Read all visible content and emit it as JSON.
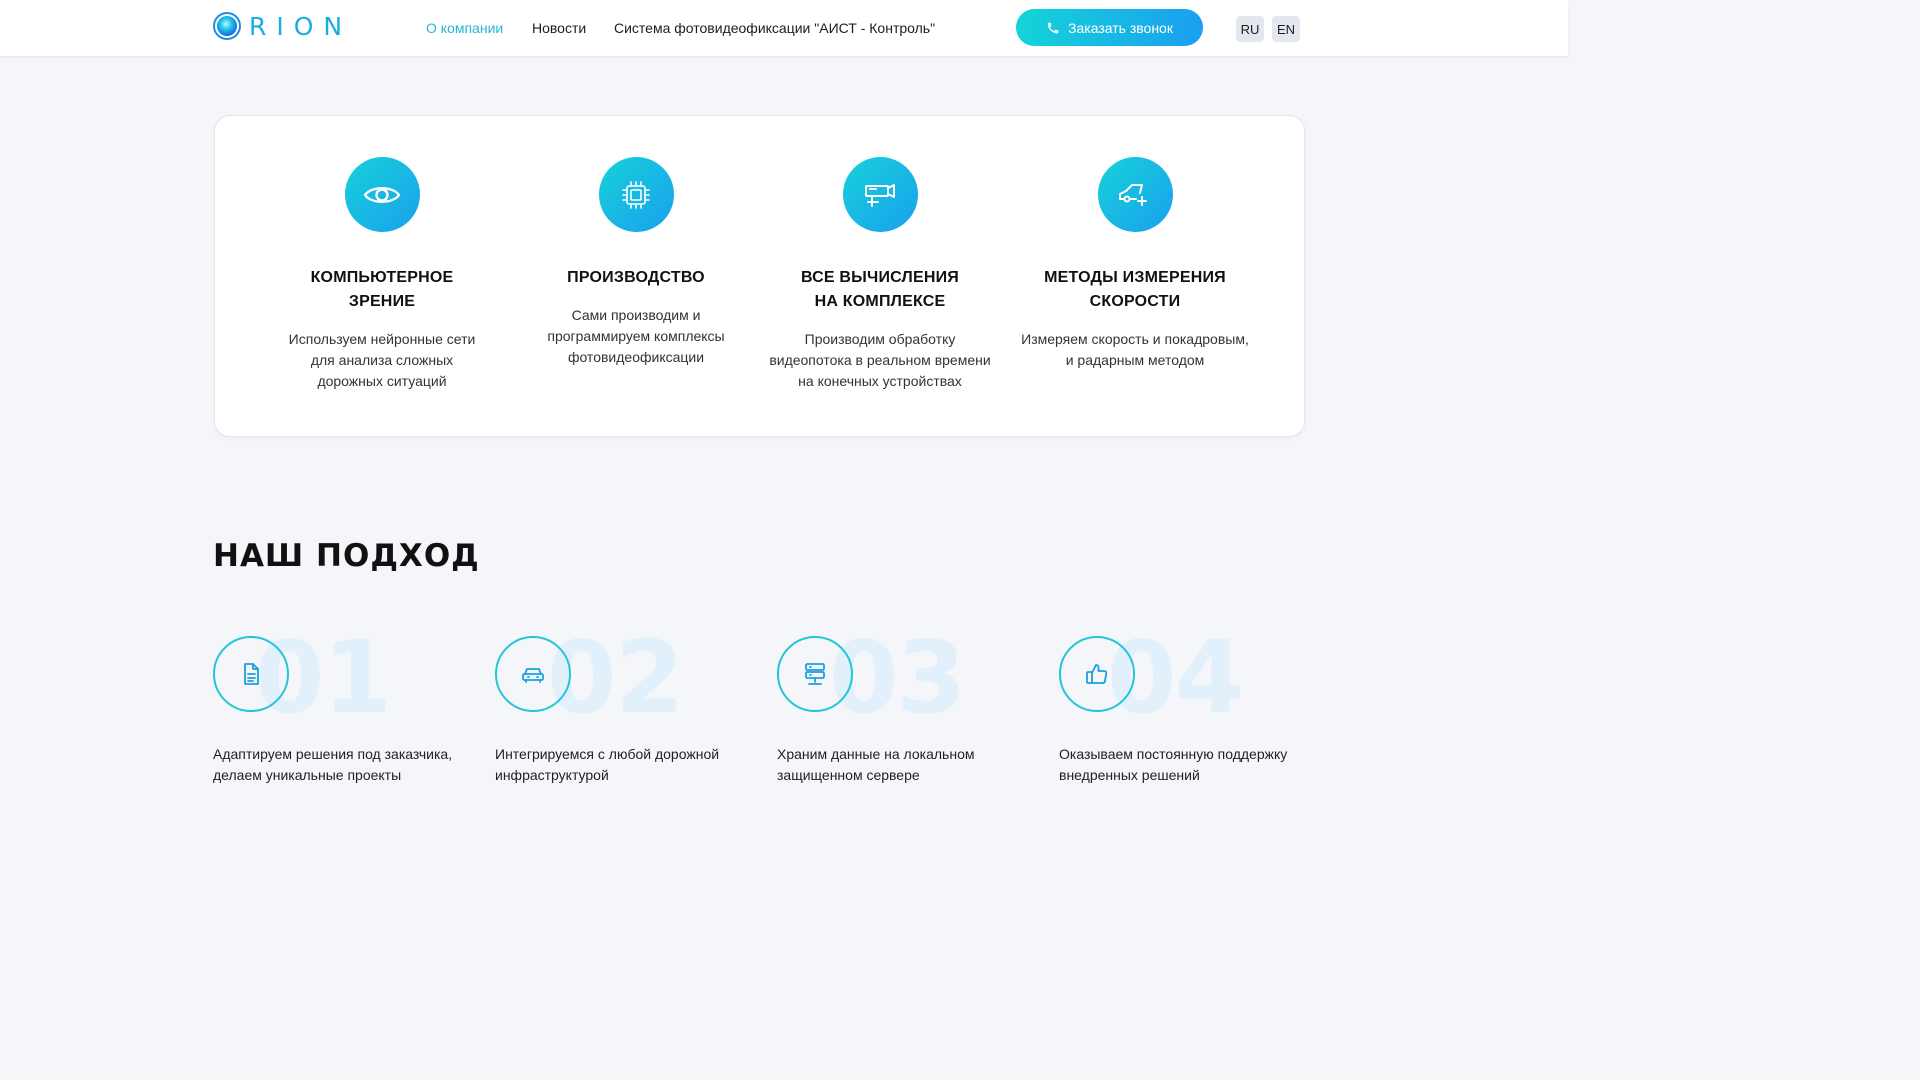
{
  "header": {
    "logo_text": "RION",
    "nav": [
      "О компании",
      "Новости",
      "Система фотовидеофиксации \"АИСТ - Контроль\""
    ],
    "call_button": "Заказать звонок",
    "languages": [
      "RU",
      "EN"
    ]
  },
  "features": [
    {
      "icon": "eye-icon",
      "title": "Компьютерное зрение",
      "text": "Используем нейронные сети\nдля анализа сложных\nдорожных ситуаций"
    },
    {
      "icon": "chip-icon",
      "title": "Производство",
      "text": "Сами производим и\nпрограммируем комплексы\nфотовидеофиксации"
    },
    {
      "icon": "camera-icon",
      "title": "Все вычисления\nна комплексе",
      "text": "Производим обработку\nвидеопотока в реальном времени\nна конечных устройствах"
    },
    {
      "icon": "speed-car-icon",
      "title": "Методы измерения\nскорости",
      "text": "Измеряем скорость и покадровым,\nи радарным методом"
    }
  ],
  "approach": {
    "title": "НАШ ПОДХОД",
    "steps": [
      {
        "num": "01",
        "icon": "document-icon",
        "text": "Адаптируем решения под заказчика,\nделаем уникальные проекты"
      },
      {
        "num": "02",
        "icon": "car-icon",
        "text": "Интегрируемся с любой дорожной\nинфраструктурой"
      },
      {
        "num": "03",
        "icon": "server-icon",
        "text": "Храним данные на локальном\nзащищенном сервере"
      },
      {
        "num": "04",
        "icon": "thumbs-up-icon",
        "text": "Оказываем постоянную поддержку\nвнедренных решений"
      }
    ]
  },
  "colors": {
    "accent": "#27b7d6",
    "gradient_start": "#14d4d8",
    "gradient_end": "#1a9ff0",
    "background": "#f4f6fa"
  }
}
